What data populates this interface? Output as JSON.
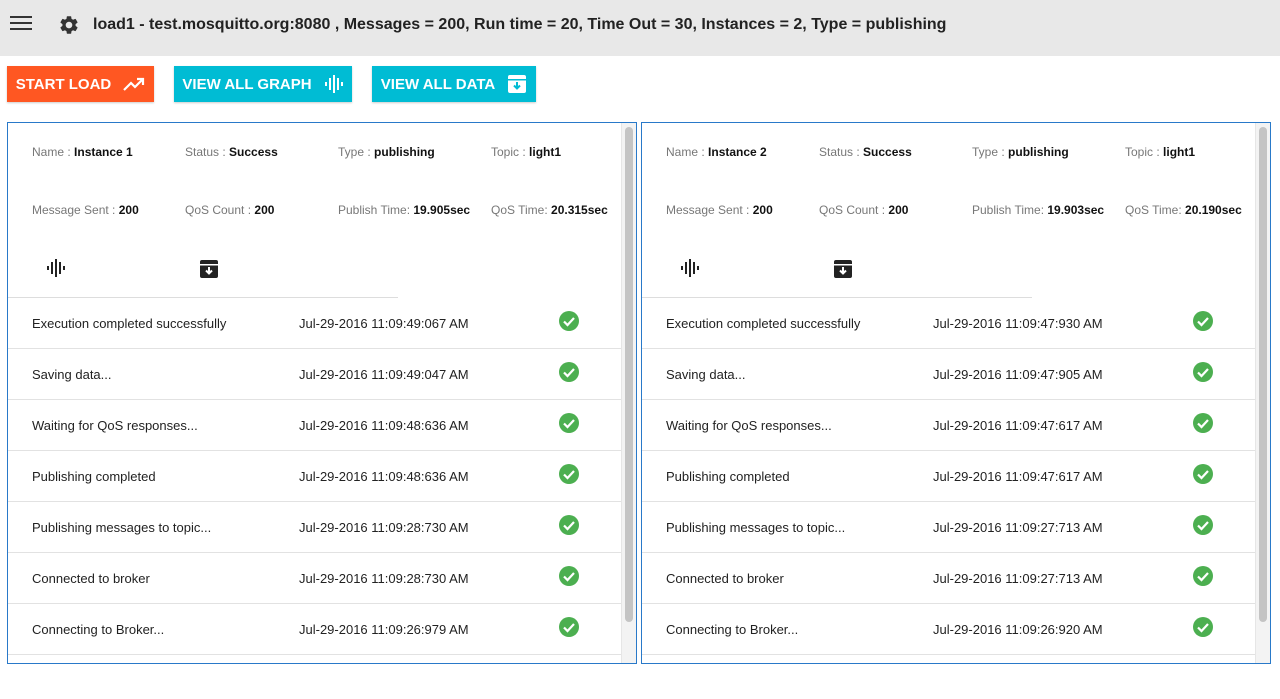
{
  "header": {
    "title": "load1 - test.mosquitto.org:8080 , Messages = 200, Run time = 20, Time Out = 30, Instances = 2, Type = publishing",
    "menu_icon": "hamburger-menu-icon",
    "settings_icon": "gear-icon"
  },
  "toolbar": {
    "start_label": "START LOAD",
    "start_icon": "trending-up-icon",
    "graph_label": "VIEW ALL GRAPH",
    "graph_icon": "waveform-icon",
    "data_label": "VIEW ALL DATA",
    "data_icon": "archive-download-icon"
  },
  "colors": {
    "start_button": "#ff5722",
    "secondary_button": "#00bcd4",
    "panel_border": "#2979c9",
    "success_check": "#4caf50"
  },
  "labels": {
    "name": "Name",
    "status": "Status",
    "type": "Type",
    "topic": "Topic",
    "message_sent": "Message Sent",
    "qos_count": "QoS Count",
    "publish_time": "Publish Time:",
    "qos_time": "QoS Time:"
  },
  "instances": [
    {
      "name": "Instance 1",
      "status": "Success",
      "type": "publishing",
      "topic": "light1",
      "message_sent": "200",
      "qos_count": "200",
      "publish_time": "19.905sec",
      "qos_time": "20.315sec",
      "logs": [
        {
          "message": "Execution completed successfully",
          "time": "Jul-29-2016 11:09:49:067 AM",
          "status": "success"
        },
        {
          "message": "Saving data...",
          "time": "Jul-29-2016 11:09:49:047 AM",
          "status": "success"
        },
        {
          "message": "Waiting for QoS responses...",
          "time": "Jul-29-2016 11:09:48:636 AM",
          "status": "success"
        },
        {
          "message": "Publishing completed",
          "time": "Jul-29-2016 11:09:48:636 AM",
          "status": "success"
        },
        {
          "message": "Publishing messages to topic...",
          "time": "Jul-29-2016 11:09:28:730 AM",
          "status": "success"
        },
        {
          "message": "Connected to broker",
          "time": "Jul-29-2016 11:09:28:730 AM",
          "status": "success"
        },
        {
          "message": "Connecting to Broker...",
          "time": "Jul-29-2016 11:09:26:979 AM",
          "status": "success"
        }
      ]
    },
    {
      "name": "Instance 2",
      "status": "Success",
      "type": "publishing",
      "topic": "light1",
      "message_sent": "200",
      "qos_count": "200",
      "publish_time": "19.903sec",
      "qos_time": "20.190sec",
      "logs": [
        {
          "message": "Execution completed successfully",
          "time": "Jul-29-2016 11:09:47:930 AM",
          "status": "success"
        },
        {
          "message": "Saving data...",
          "time": "Jul-29-2016 11:09:47:905 AM",
          "status": "success"
        },
        {
          "message": "Waiting for QoS responses...",
          "time": "Jul-29-2016 11:09:47:617 AM",
          "status": "success"
        },
        {
          "message": "Publishing completed",
          "time": "Jul-29-2016 11:09:47:617 AM",
          "status": "success"
        },
        {
          "message": "Publishing messages to topic...",
          "time": "Jul-29-2016 11:09:27:713 AM",
          "status": "success"
        },
        {
          "message": "Connected to broker",
          "time": "Jul-29-2016 11:09:27:713 AM",
          "status": "success"
        },
        {
          "message": "Connecting to Broker...",
          "time": "Jul-29-2016 11:09:26:920 AM",
          "status": "success"
        }
      ]
    }
  ]
}
